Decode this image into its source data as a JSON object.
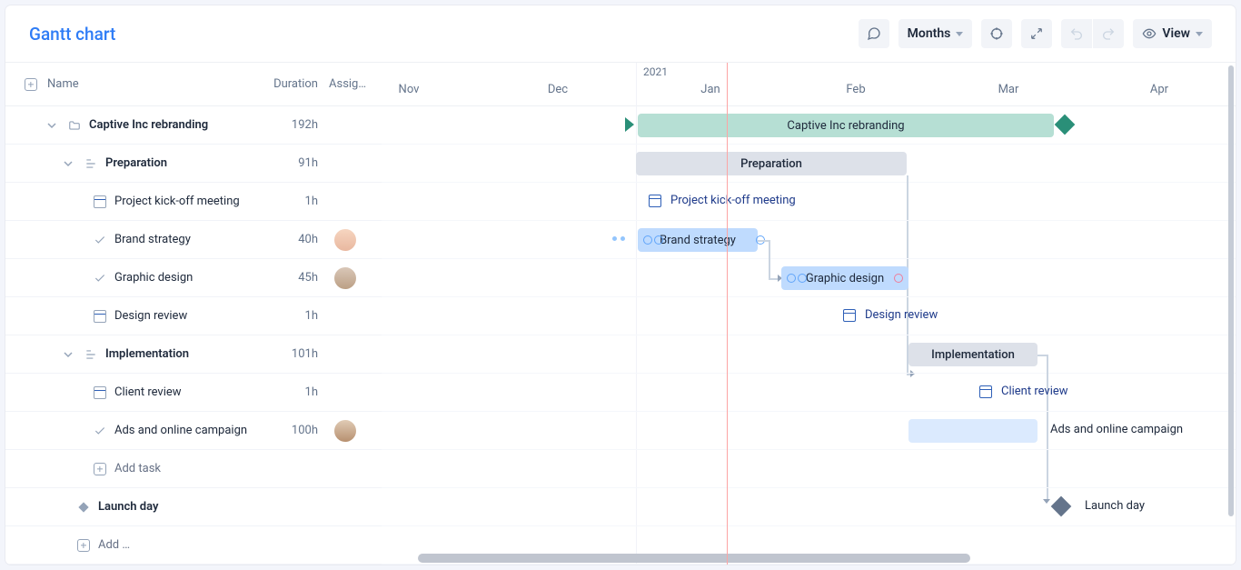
{
  "title": "Gantt chart",
  "toolbar": {
    "timescale_label": "Months",
    "view_label": "View"
  },
  "columns": {
    "name": "Name",
    "duration": "Duration",
    "assignee": "Assig…"
  },
  "year_label": "2021",
  "months": [
    "Nov",
    "Dec",
    "Jan",
    "Feb",
    "Mar",
    "Apr"
  ],
  "add_task_label": "Add task",
  "add_label": "Add …",
  "rows": [
    {
      "id": "project",
      "type": "group",
      "indent": 0,
      "icon": "folder",
      "label": "Captive Inc rebranding",
      "duration": "192h",
      "expand": true
    },
    {
      "id": "prep",
      "type": "group",
      "indent": 1,
      "icon": "subtask",
      "label": "Preparation",
      "duration": "91h",
      "expand": true
    },
    {
      "id": "kickoff",
      "type": "task",
      "indent": 2,
      "icon": "calendar",
      "label": "Project kick-off meeting",
      "duration": "1h"
    },
    {
      "id": "brand",
      "type": "task",
      "indent": 2,
      "icon": "check",
      "label": "Brand strategy",
      "duration": "40h",
      "assignee": "a"
    },
    {
      "id": "graphic",
      "type": "task",
      "indent": 2,
      "icon": "check",
      "label": "Graphic design",
      "duration": "45h",
      "assignee": "b"
    },
    {
      "id": "design-rev",
      "type": "task",
      "indent": 2,
      "icon": "calendar",
      "label": "Design review",
      "duration": "1h"
    },
    {
      "id": "impl",
      "type": "group",
      "indent": 1,
      "icon": "subtask",
      "label": "Implementation",
      "duration": "101h",
      "expand": true
    },
    {
      "id": "client-rev",
      "type": "task",
      "indent": 2,
      "icon": "calendar",
      "label": "Client review",
      "duration": "1h"
    },
    {
      "id": "ads",
      "type": "task",
      "indent": 2,
      "icon": "check",
      "label": "Ads and online campaign",
      "duration": "100h",
      "assignee": "c"
    },
    {
      "id": "addtask",
      "type": "add",
      "indent": 2
    },
    {
      "id": "launch",
      "type": "milestone",
      "indent": 1,
      "icon": "diamond",
      "label": "Launch day"
    },
    {
      "id": "addgroup",
      "type": "add",
      "indent": 1
    }
  ],
  "bars": {
    "project": {
      "label": "Captive Inc rebranding"
    },
    "prep": {
      "label": "Preparation"
    },
    "kickoff": {
      "label": "Project kick-off meeting"
    },
    "brand": {
      "label": "Brand strategy"
    },
    "graphic": {
      "label": "Graphic design"
    },
    "design_rev": {
      "label": "Design review"
    },
    "impl": {
      "label": "Implementation"
    },
    "client_rev": {
      "label": "Client review"
    },
    "ads": {
      "label": "Ads and online campaign"
    },
    "launch": {
      "label": "Launch day"
    }
  },
  "chart_data": {
    "type": "gantt",
    "time_axis": {
      "start": "2020-11",
      "end": "2021-04",
      "today_marker": "~2021-01-05",
      "unit": "month"
    },
    "tasks": [
      {
        "id": "project",
        "name": "Captive Inc rebranding",
        "type": "summary",
        "start": "2021-01-01",
        "end": "2021-03-01"
      },
      {
        "id": "prep",
        "name": "Preparation",
        "type": "group",
        "start": "2021-01-01",
        "end": "2021-02-01",
        "parent": "project"
      },
      {
        "id": "kickoff",
        "name": "Project kick-off meeting",
        "type": "milestone-task",
        "date": "2021-01-03",
        "parent": "prep"
      },
      {
        "id": "brand",
        "name": "Brand strategy",
        "start": "2021-01-01",
        "end": "2021-01-18",
        "parent": "prep",
        "progress_rings": 4
      },
      {
        "id": "graphic",
        "name": "Graphic design",
        "start": "2021-01-19",
        "end": "2021-02-01",
        "parent": "prep",
        "depends_on": [
          "brand"
        ]
      },
      {
        "id": "design-rev",
        "name": "Design review",
        "type": "milestone-task",
        "date": "2021-02-03",
        "parent": "prep",
        "depends_on": [
          "graphic"
        ]
      },
      {
        "id": "impl",
        "name": "Implementation",
        "type": "group",
        "start": "2021-02-03",
        "end": "2021-02-20",
        "parent": "project",
        "depends_on": [
          "prep"
        ]
      },
      {
        "id": "client-rev",
        "name": "Client review",
        "type": "milestone-task",
        "date": "2021-02-25",
        "parent": "impl",
        "depends_on": [
          "impl"
        ]
      },
      {
        "id": "ads",
        "name": "Ads and online campaign",
        "start": "2021-02-03",
        "end": "2021-02-20",
        "parent": "impl"
      },
      {
        "id": "launch",
        "name": "Launch day",
        "type": "milestone",
        "date": "2021-03-01",
        "depends_on": [
          "impl"
        ]
      }
    ]
  }
}
